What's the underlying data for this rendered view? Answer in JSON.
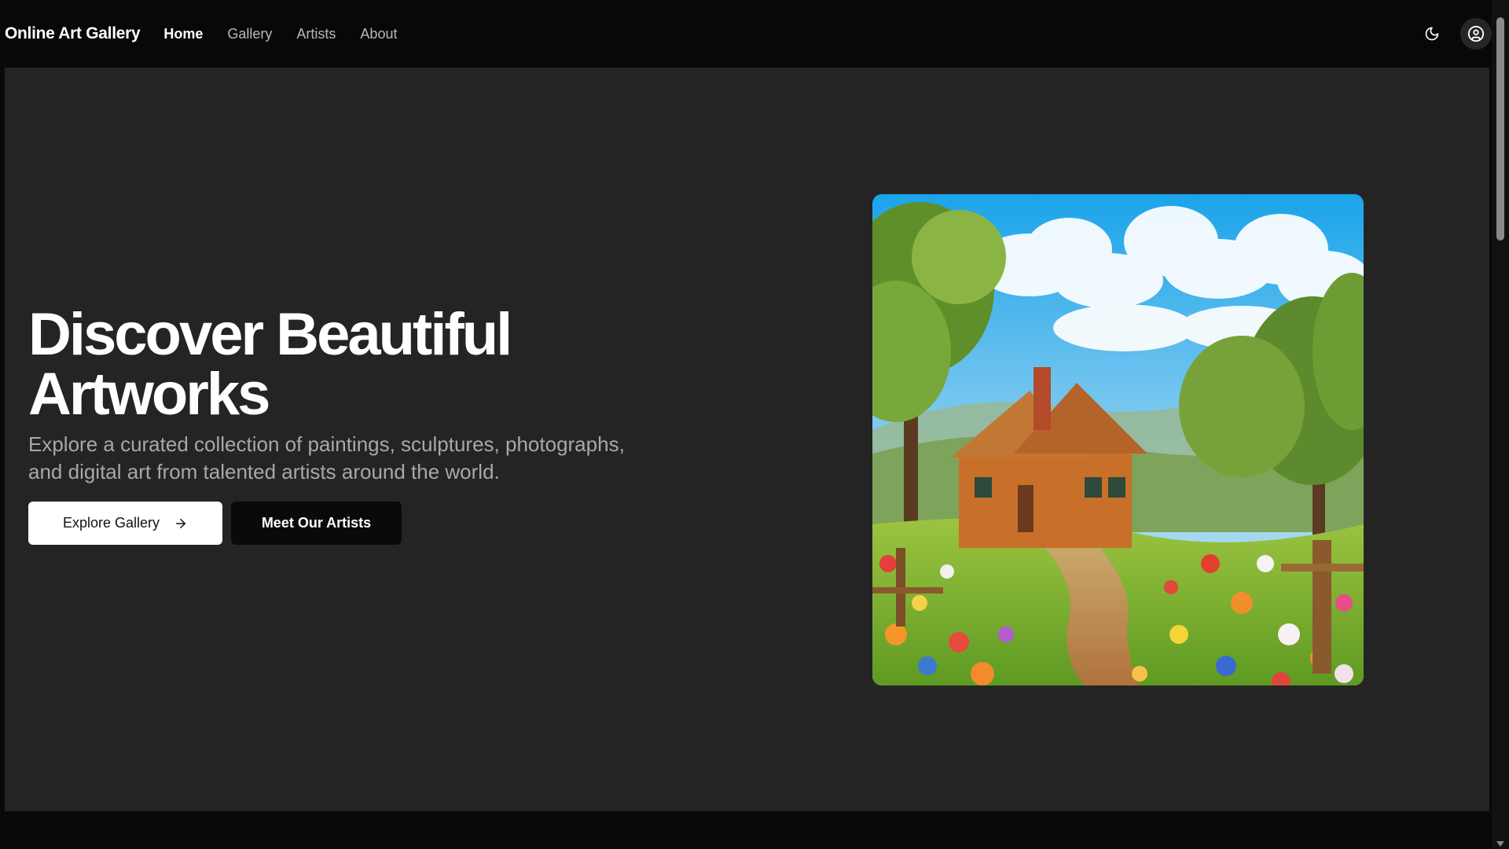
{
  "header": {
    "brand": "Online Art Gallery",
    "nav": [
      {
        "label": "Home",
        "active": true
      },
      {
        "label": "Gallery",
        "active": false
      },
      {
        "label": "Artists",
        "active": false
      },
      {
        "label": "About",
        "active": false
      }
    ],
    "icons": {
      "theme_toggle": "moon-icon",
      "account": "user-circle-icon"
    }
  },
  "hero": {
    "headline": "Discover Beautiful Artworks",
    "subtitle": "Explore a curated collection of paintings, sculptures, photographs, and digital art from talented artists around the world.",
    "primary_cta": {
      "label": "Explore Gallery",
      "icon": "arrow-right-icon"
    },
    "secondary_cta": {
      "label": "Meet Our Artists"
    },
    "artwork": {
      "subject": "painting-cottage-flower-garden"
    }
  },
  "colors": {
    "page_bg": "#080808",
    "hero_bg": "#242424",
    "text_primary": "#ffffff",
    "text_muted": "#a8a8a8",
    "nav_inactive": "#b8b8b8",
    "primary_button_bg": "#ffffff",
    "secondary_button_bg": "#0a0a0a"
  }
}
